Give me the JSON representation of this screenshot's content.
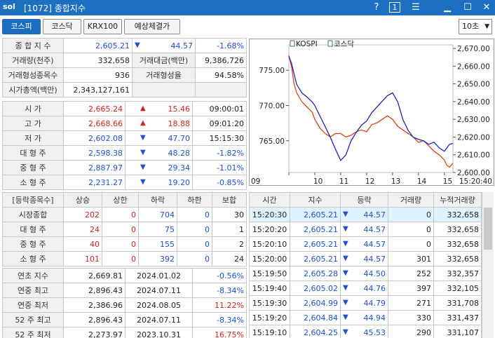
{
  "title": {
    "logo": "sol",
    "text": "[1072] 종합지수",
    "help": "?",
    "one": "1"
  },
  "tabs": [
    {
      "label": "코스피",
      "active": true
    },
    {
      "label": "코스닥",
      "active": false
    },
    {
      "label": "KRX100",
      "active": false
    },
    {
      "label": "예상체결가",
      "active": false
    }
  ],
  "interval": "10초",
  "summary": {
    "index_label": "종 합 지 수",
    "index_value": "2,605.21",
    "index_change": "44.57",
    "index_rate": "-1.68%",
    "vol_label": "거래량(천주)",
    "vol_value": "332,658",
    "amt_label": "거래대금(백만)",
    "amt_value": "9,386,726",
    "form_cnt_label": "거래형성종목수",
    "form_cnt_value": "936",
    "form_rate_label": "거래형성율",
    "form_rate_value": "94.58%",
    "cap_label": "시가총액(백만)",
    "cap_value": "2,343,127,161"
  },
  "prices": [
    {
      "label": "시 가",
      "value": "2,665.24",
      "dir": "▲",
      "change": "15.46",
      "extra": "09:00:01",
      "color": "red"
    },
    {
      "label": "고 가",
      "value": "2,668.66",
      "dir": "▲",
      "change": "18.88",
      "extra": "09:01:20",
      "color": "red"
    },
    {
      "label": "저 가",
      "value": "2,602.08",
      "dir": "▼",
      "change": "47.70",
      "extra": "15:15:30",
      "color": "blue"
    },
    {
      "label": "대 형 주",
      "value": "2,598.38",
      "dir": "▼",
      "change": "48.28",
      "extra": "-1.82%",
      "color": "blue"
    },
    {
      "label": "중 형 주",
      "value": "2,887.97",
      "dir": "▼",
      "change": "29.34",
      "extra": "-1.01%",
      "color": "blue"
    },
    {
      "label": "소 형 주",
      "value": "2,231.27",
      "dir": "▼",
      "change": "19.20",
      "extra": "-0.85%",
      "color": "blue"
    }
  ],
  "breadth": {
    "headers": [
      "[등락종목수]",
      "상승",
      "상한",
      "하락",
      "하한",
      "보합"
    ],
    "rows": [
      {
        "label": "시장종합",
        "up": "202",
        "upl": "0",
        "down": "704",
        "downl": "0",
        "flat": "30"
      },
      {
        "label": "대 형 주",
        "up": "24",
        "upl": "0",
        "down": "75",
        "downl": "0",
        "flat": "1"
      },
      {
        "label": "중 형 주",
        "up": "40",
        "upl": "0",
        "down": "155",
        "downl": "0",
        "flat": "2"
      },
      {
        "label": "소 형 주",
        "up": "101",
        "upl": "0",
        "down": "392",
        "downl": "0",
        "flat": "24"
      }
    ]
  },
  "yearly": [
    {
      "label": "연초 지수",
      "value": "2,669.81",
      "date": "2024.01.02",
      "rate": "-0.56%",
      "color": "blue"
    },
    {
      "label": "연중 최고",
      "value": "2,896.43",
      "date": "2024.07.11",
      "rate": "-8.34%",
      "color": "blue"
    },
    {
      "label": "연중 최저",
      "value": "2,386.96",
      "date": "2024.08.05",
      "rate": "11.22%",
      "color": "red"
    },
    {
      "label": "52 주 최고",
      "value": "2,896.43",
      "date": "2024.07.11",
      "rate": "-8.34%",
      "color": "blue"
    },
    {
      "label": "52 주 최저",
      "value": "2,273.97",
      "date": "2023.10.31",
      "rate": "16.75%",
      "color": "red"
    }
  ],
  "ticks": {
    "headers": [
      "시간",
      "지수",
      "등락",
      "거래량",
      "누적거래량"
    ],
    "rows": [
      {
        "time": "15:20:30",
        "idx": "2,605.21",
        "dir": "▼",
        "chg": "44.57",
        "vol": "0",
        "cum": "332,658"
      },
      {
        "time": "15:20:20",
        "idx": "2,605.21",
        "dir": "▼",
        "chg": "44.57",
        "vol": "0",
        "cum": "332,658"
      },
      {
        "time": "15:20:10",
        "idx": "2,605.21",
        "dir": "▼",
        "chg": "44.57",
        "vol": "0",
        "cum": "332,658"
      },
      {
        "time": "15:20:00",
        "idx": "2,605.21",
        "dir": "▼",
        "chg": "44.57",
        "vol": "301",
        "cum": "332,658"
      },
      {
        "time": "15:19:50",
        "idx": "2,605.28",
        "dir": "▼",
        "chg": "44.50",
        "vol": "252",
        "cum": "332,357"
      },
      {
        "time": "15:19:40",
        "idx": "2,605.02",
        "dir": "▼",
        "chg": "44.76",
        "vol": "397",
        "cum": "332,105"
      },
      {
        "time": "15:19:30",
        "idx": "2,604.99",
        "dir": "▼",
        "chg": "44.79",
        "vol": "271",
        "cum": "331,708"
      },
      {
        "time": "15:19:20",
        "idx": "2,604.84",
        "dir": "▼",
        "chg": "44.94",
        "vol": "330",
        "cum": "331,437"
      },
      {
        "time": "15:19:10",
        "idx": "2,604.25",
        "dir": "▼",
        "chg": "45.53",
        "vol": "290",
        "cum": "331,107"
      }
    ]
  },
  "chart_data": {
    "type": "line",
    "legend": [
      "KOSPI",
      "코스닥"
    ],
    "x_ticks": [
      "09",
      "10",
      "11",
      "12",
      "13",
      "14",
      "15",
      "15:20:40"
    ],
    "y_left_ticks": [
      "775.00",
      "770.00",
      "765.00"
    ],
    "y_right_ticks": [
      "2,670.00",
      "2,660.00",
      "2,650.00",
      "2,640.00",
      "2,630.00",
      "2,620.00",
      "2,610.00",
      "2,600.00"
    ],
    "y_left_range": [
      760.5,
      778.6
    ],
    "y_right_range": [
      2600,
      2672
    ],
    "series": [
      {
        "name": "KOSPI",
        "color": "#d2441a",
        "axis": "right",
        "x": [
          9.0,
          9.1,
          9.2,
          9.3,
          9.5,
          9.7,
          9.9,
          10.0,
          10.2,
          10.4,
          10.6,
          10.8,
          11.0,
          11.2,
          11.4,
          11.6,
          11.8,
          12.0,
          12.2,
          12.4,
          12.6,
          12.8,
          13.0,
          13.2,
          13.4,
          13.6,
          13.8,
          14.0,
          14.2,
          14.4,
          14.6,
          14.8,
          15.0,
          15.1,
          15.2,
          15.33
        ],
        "y": [
          2666,
          2660,
          2650,
          2645,
          2640,
          2637,
          2634,
          2630,
          2625,
          2622,
          2620,
          2622,
          2622,
          2620,
          2621,
          2623,
          2624,
          2623,
          2627,
          2628,
          2630,
          2632,
          2630,
          2626,
          2624,
          2622,
          2620,
          2617,
          2618,
          2615,
          2612,
          2610,
          2607,
          2604,
          2603,
          2605.2
        ]
      },
      {
        "name": "코스닥",
        "color": "#2520b8",
        "axis": "left",
        "x": [
          9.0,
          9.1,
          9.2,
          9.3,
          9.5,
          9.7,
          9.9,
          10.0,
          10.2,
          10.4,
          10.6,
          10.8,
          11.0,
          11.2,
          11.4,
          11.6,
          11.8,
          12.0,
          12.2,
          12.4,
          12.6,
          12.8,
          13.0,
          13.2,
          13.4,
          13.6,
          13.8,
          14.0,
          14.2,
          14.4,
          14.6,
          14.8,
          15.0,
          15.1,
          15.2,
          15.33
        ],
        "y": [
          777.0,
          776.0,
          774.5,
          773.0,
          771.8,
          771.2,
          770.5,
          770.0,
          768.5,
          767.0,
          765.5,
          763.8,
          762.2,
          763.0,
          765.0,
          766.2,
          767.2,
          767.8,
          769.0,
          769.8,
          770.6,
          771.4,
          771.8,
          770.5,
          768.0,
          766.5,
          765.5,
          765.2,
          765.0,
          764.5,
          764.8,
          764.0,
          763.5,
          764.0,
          764.5,
          764.6
        ]
      }
    ]
  }
}
